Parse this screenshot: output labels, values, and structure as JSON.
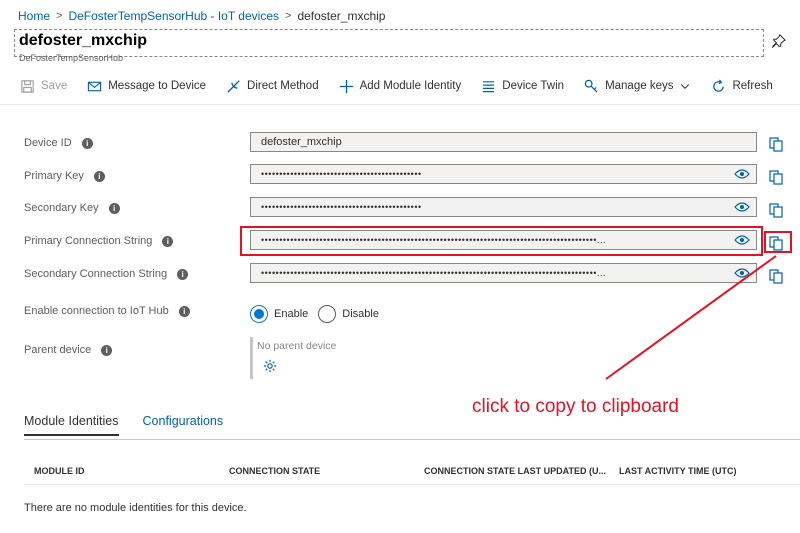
{
  "breadcrumb": {
    "items": [
      "Home",
      "DeFosterTempSensorHub - IoT devices",
      "defoster_mxchip"
    ]
  },
  "header": {
    "title": "defoster_mxchip",
    "subtitle": "DeFosterTempSensorHub"
  },
  "toolbar": {
    "save": "Save",
    "message": "Message to Device",
    "direct_method": "Direct Method",
    "add_module": "Add Module Identity",
    "device_twin": "Device Twin",
    "manage_keys": "Manage keys",
    "refresh": "Refresh"
  },
  "fields": {
    "device_id": {
      "label": "Device ID",
      "value": "defoster_mxchip"
    },
    "primary_key": {
      "label": "Primary Key",
      "value": "••••••••••••••••••••••••••••••••••••••••••••"
    },
    "secondary_key": {
      "label": "Secondary Key",
      "value": "••••••••••••••••••••••••••••••••••••••••••••"
    },
    "primary_conn": {
      "label": "Primary Connection String",
      "value": "••••••••••••••••••••••••••••••••••••••••••••••••••••••••••••••••••••••••••••••••••••••••••••..."
    },
    "secondary_conn": {
      "label": "Secondary Connection String",
      "value": "••••••••••••••••••••••••••••••••••••••••••••••••••••••••••••••••••••••••••••••••••••••••••••..."
    }
  },
  "connection": {
    "label": "Enable connection to IoT Hub",
    "enable": "Enable",
    "disable": "Disable",
    "selected": "Enable"
  },
  "parent": {
    "label": "Parent device",
    "value": "No parent device"
  },
  "annotation": {
    "text": "click to copy to clipboard",
    "color": "#e81123"
  },
  "tabs": [
    "Module Identities",
    "Configurations"
  ],
  "table": {
    "columns": [
      "MODULE ID",
      "CONNECTION STATE",
      "CONNECTION STATE LAST UPDATED (U...",
      "LAST ACTIVITY TIME (UTC)"
    ],
    "empty_message": "There are no module identities for this device."
  },
  "colors": {
    "accent": "#0078d4",
    "link": "#0062ad",
    "highlight": "#e81123"
  }
}
